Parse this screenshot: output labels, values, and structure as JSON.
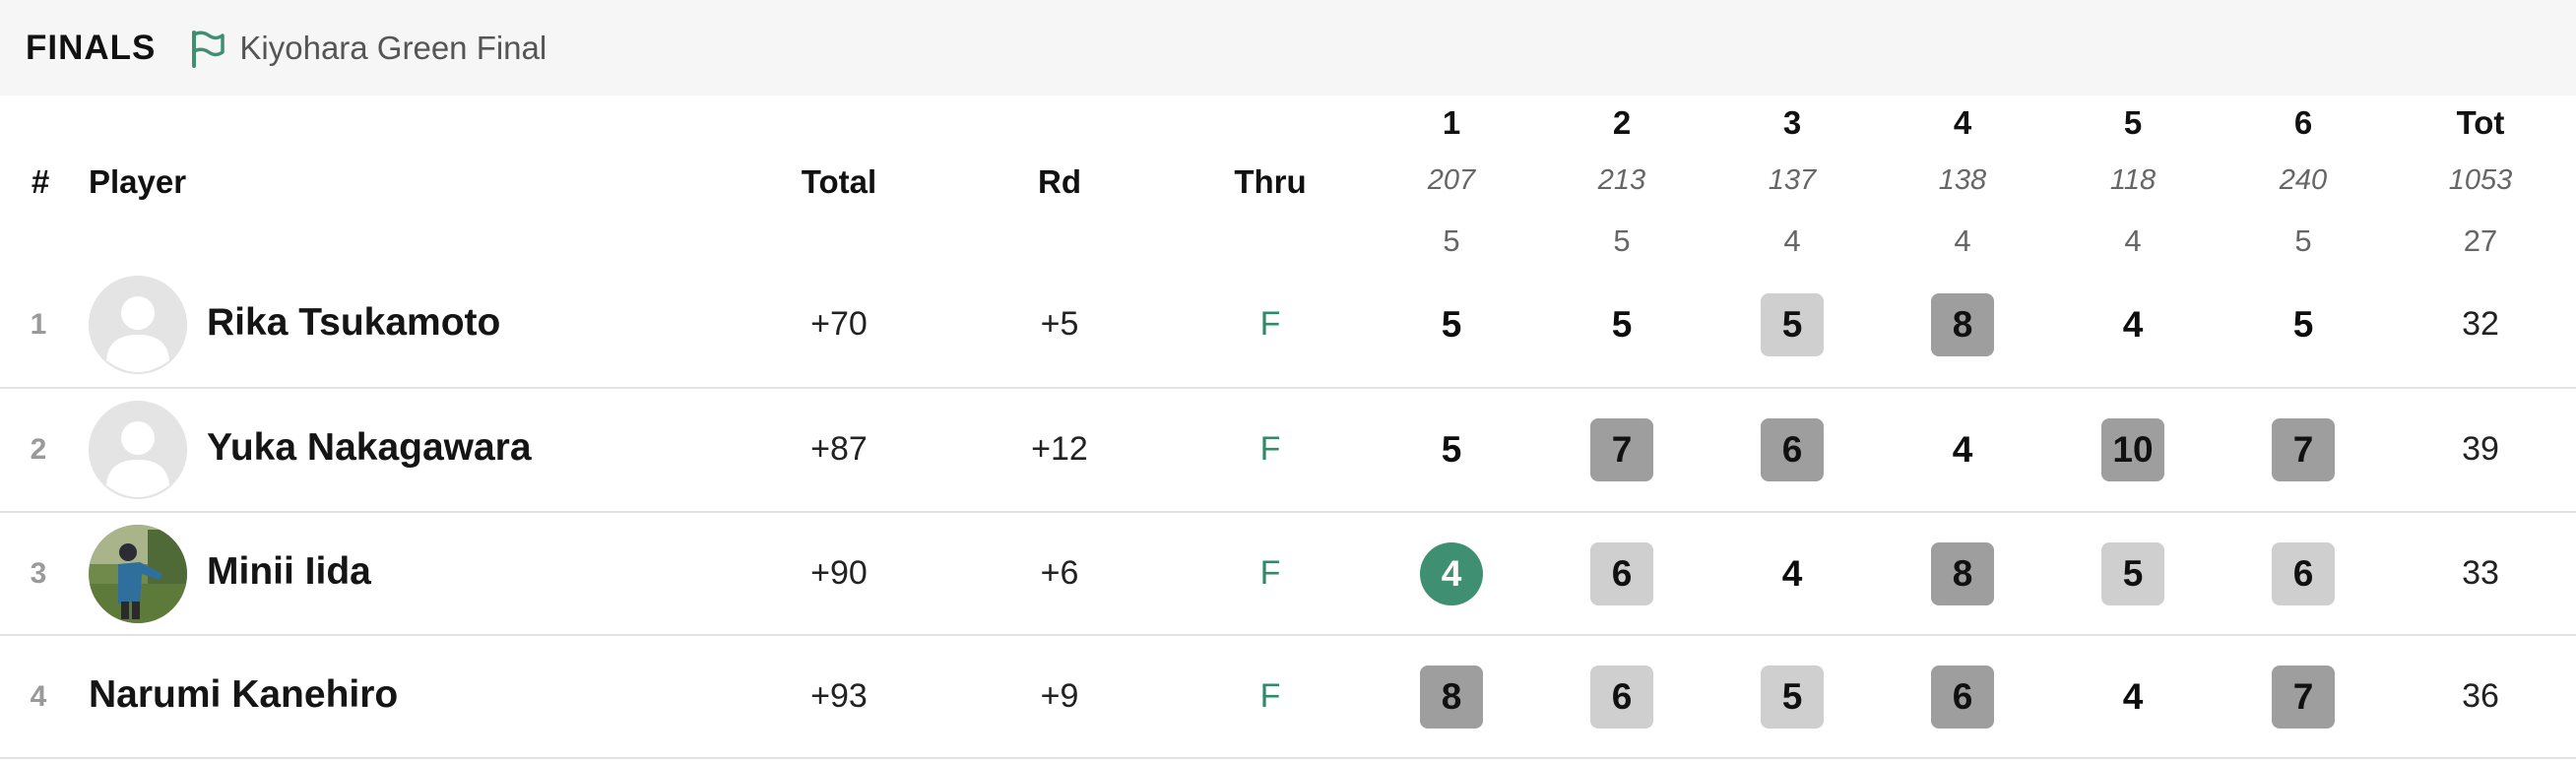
{
  "header": {
    "title": "FINALS",
    "round_label": "Kiyohara Green Final",
    "flag_icon": "flag-icon",
    "accent_color": "#3f8f72"
  },
  "columns": {
    "rank": "#",
    "player": "Player",
    "total": "Total",
    "rd": "Rd",
    "thru": "Thru",
    "tot": "Tot"
  },
  "holes": [
    {
      "num": "1",
      "dist": "207",
      "par": "5"
    },
    {
      "num": "2",
      "dist": "213",
      "par": "5"
    },
    {
      "num": "3",
      "dist": "137",
      "par": "4"
    },
    {
      "num": "4",
      "dist": "138",
      "par": "4"
    },
    {
      "num": "5",
      "dist": "118",
      "par": "4"
    },
    {
      "num": "6",
      "dist": "240",
      "par": "5"
    }
  ],
  "totals_header": {
    "dist": "1053",
    "par": "27"
  },
  "players": [
    {
      "rank": "1",
      "name": "Rika Tsukamoto",
      "avatar": "default-avatar",
      "total": "+70",
      "rd": "+5",
      "thru": "F",
      "scores": [
        "5",
        "5",
        "5",
        "8",
        "4",
        "5"
      ],
      "score_types": [
        "par",
        "par",
        "bogey",
        "dbl",
        "par",
        "par"
      ],
      "tot": "32"
    },
    {
      "rank": "2",
      "name": "Yuka Nakagawara",
      "avatar": "default-avatar",
      "total": "+87",
      "rd": "+12",
      "thru": "F",
      "scores": [
        "5",
        "7",
        "6",
        "4",
        "10",
        "7"
      ],
      "score_types": [
        "par",
        "dbl",
        "dbl",
        "par",
        "dbl",
        "dbl"
      ],
      "tot": "39"
    },
    {
      "rank": "3",
      "name": "Minii Iida",
      "avatar": "photo-avatar",
      "total": "+90",
      "rd": "+6",
      "thru": "F",
      "scores": [
        "4",
        "6",
        "4",
        "8",
        "5",
        "6"
      ],
      "score_types": [
        "birdie",
        "bogey",
        "par",
        "dbl",
        "bogey",
        "bogey"
      ],
      "tot": "33"
    },
    {
      "rank": "4",
      "name": "Narumi Kanehiro",
      "avatar": "none",
      "total": "+93",
      "rd": "+9",
      "thru": "F",
      "scores": [
        "8",
        "6",
        "5",
        "6",
        "4",
        "7"
      ],
      "score_types": [
        "dbl",
        "bogey",
        "bogey",
        "dbl",
        "par",
        "dbl"
      ],
      "tot": "36"
    }
  ]
}
